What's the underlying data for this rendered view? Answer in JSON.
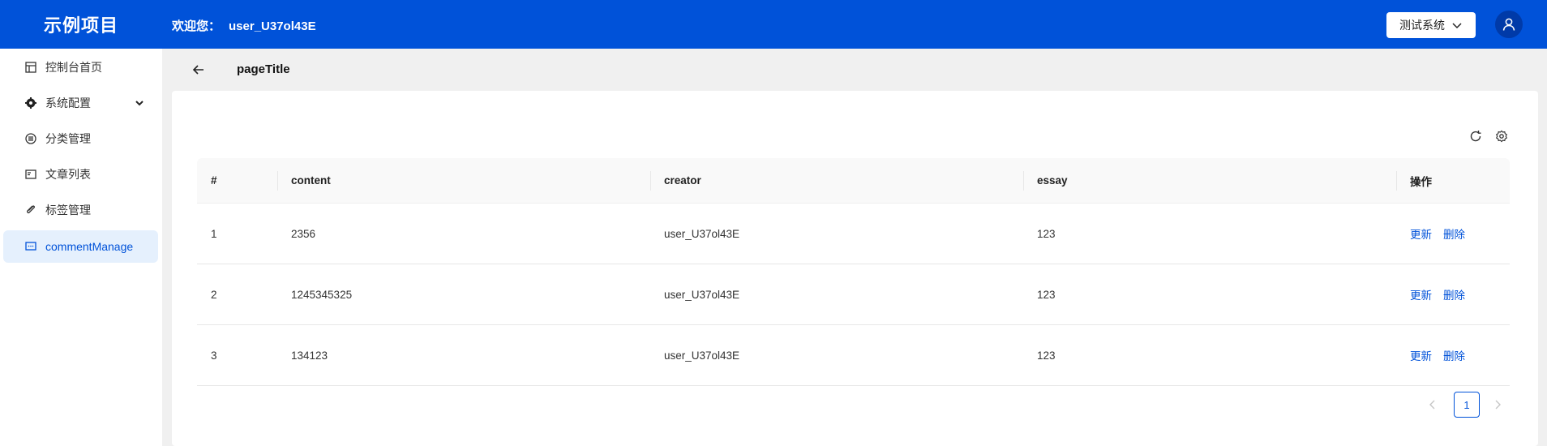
{
  "header": {
    "logo": "示例项目",
    "welcome_label": "欢迎您：",
    "username": "user_U37ol43E",
    "system_select": "测试系统",
    "accent": "#0052d9"
  },
  "sidebar": {
    "items": [
      {
        "label": "控制台首页",
        "icon": "dashboard-icon"
      },
      {
        "label": "系统配置",
        "icon": "gear-icon"
      },
      {
        "label": "分类管理",
        "icon": "list-icon"
      },
      {
        "label": "文章列表",
        "icon": "article-icon"
      },
      {
        "label": "标签管理",
        "icon": "tag-icon"
      },
      {
        "label": "commentManage",
        "icon": "comment-icon"
      }
    ]
  },
  "page": {
    "title": "pageTitle"
  },
  "table": {
    "columns": [
      "#",
      "content",
      "creator",
      "essay",
      "操作"
    ],
    "rows": [
      {
        "index": "1",
        "content": "2356",
        "creator": "user_U37ol43E",
        "essay": "123"
      },
      {
        "index": "2",
        "content": "1245345325",
        "creator": "user_U37ol43E",
        "essay": "123"
      },
      {
        "index": "3",
        "content": "134123",
        "creator": "user_U37ol43E",
        "essay": "123"
      }
    ],
    "actions": {
      "update": "更新",
      "delete": "删除"
    }
  },
  "pagination": {
    "current": "1"
  }
}
